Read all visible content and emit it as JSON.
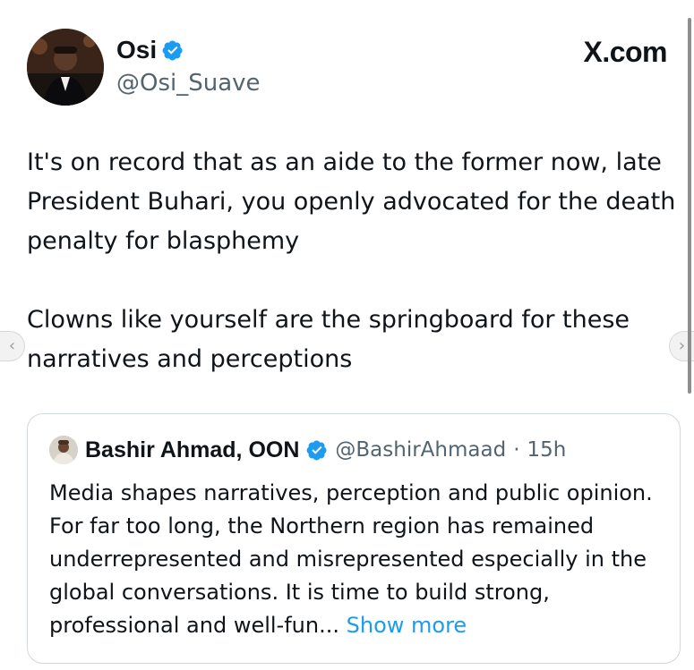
{
  "post": {
    "author": {
      "name": "Osi",
      "handle": "@Osi_Suave",
      "verified": true
    },
    "site_label": "X.com",
    "paragraphs": [
      "It's on record that as an aide to the former now, late President Buhari, you openly advocated for the death penalty for blasphemy",
      "Clowns like yourself are the springboard for these narratives and perceptions"
    ],
    "quote": {
      "name": "Bashir Ahmad, OON",
      "handle": "@BashirAhmaad",
      "separator": "·",
      "time": "15h",
      "verified": true,
      "text": "Media shapes narratives, perception and public opinion. For far too long, the Northern region has remained underrepresented and misrepresented especially in the global conversations. It is time to build strong, professional and well-fun...",
      "show_more": "Show more"
    }
  },
  "carousel": {
    "prev_icon": "chevron-left-icon",
    "next_icon": "chevron-right-icon"
  },
  "colors": {
    "text": "#0f1419",
    "secondary": "#536471",
    "link": "#1d9bf0",
    "verified": "#1d9bf0",
    "border": "#cfd9de"
  }
}
